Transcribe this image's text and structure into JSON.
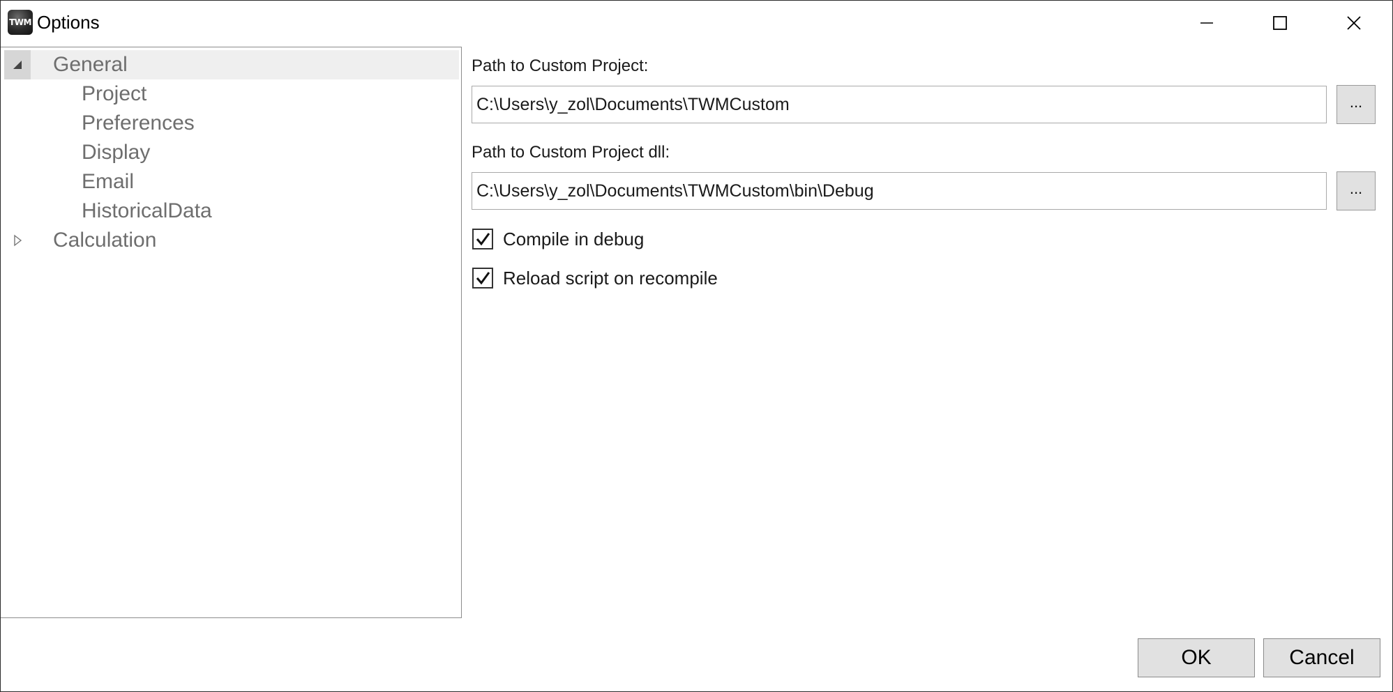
{
  "window": {
    "title": "Options",
    "logo_text": "TWM"
  },
  "titlebar_controls": {
    "minimize_icon": "minimize-icon",
    "maximize_icon": "maximize-icon",
    "close_icon": "close-icon"
  },
  "tree": {
    "items": [
      {
        "label": "General",
        "level": 0,
        "expanded": true,
        "selected": true
      },
      {
        "label": "Project",
        "level": 1
      },
      {
        "label": "Preferences",
        "level": 1
      },
      {
        "label": "Display",
        "level": 1
      },
      {
        "label": "Email",
        "level": 1
      },
      {
        "label": "HistoricalData",
        "level": 1
      },
      {
        "label": "Calculation",
        "level": 0,
        "expanded": false
      }
    ]
  },
  "settings": {
    "custom_project": {
      "label": "Path to Custom Project:",
      "value": "C:\\Users\\y_zol\\Documents\\TWMCustom",
      "browse_label": "..."
    },
    "custom_project_dll": {
      "label": "Path to Custom Project dll:",
      "value": "C:\\Users\\y_zol\\Documents\\TWMCustom\\bin\\Debug",
      "browse_label": "..."
    },
    "compile_in_debug": {
      "label": "Compile in debug",
      "checked": true
    },
    "reload_script": {
      "label": "Reload script on recompile",
      "checked": true
    }
  },
  "footer": {
    "ok_label": "OK",
    "cancel_label": "Cancel"
  },
  "colors": {
    "tree_text": "#6e6e6e",
    "selected_row": "#efefef",
    "button_face": "#e1e1e1"
  }
}
